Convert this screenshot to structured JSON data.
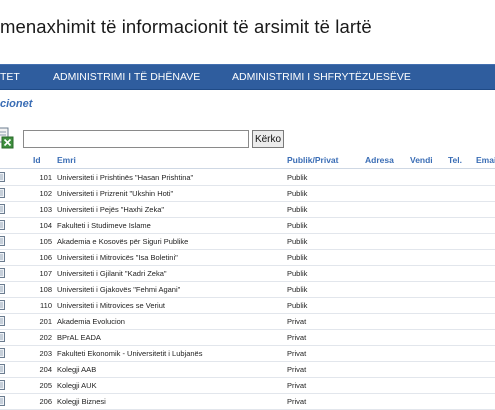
{
  "app": {
    "title": "menaxhimit të informacionit të arsimit të lartë"
  },
  "nav": {
    "items": [
      {
        "label": "TET"
      },
      {
        "label": "ADMINISTRIMI I TË DHËNAVE"
      },
      {
        "label": "ADMINISTRIMI I SHFRYTËZUESËVE"
      }
    ]
  },
  "section": {
    "title": "cionet"
  },
  "search": {
    "value": "",
    "placeholder": "",
    "button_label": "Kërko"
  },
  "table": {
    "columns": [
      "Id",
      "Emri",
      "Publik/Privat",
      "Adresa",
      "Vendi",
      "Tel.",
      "Emai"
    ],
    "rows": [
      {
        "id": "101",
        "name": "Universiteti i Prishtinës \"Hasan Prishtina\"",
        "type": "Publik"
      },
      {
        "id": "102",
        "name": "Universiteti i Prizrenit \"Ukshin Hoti\"",
        "type": "Publik"
      },
      {
        "id": "103",
        "name": "Universiteti i Pejës \"Haxhi Zeka\"",
        "type": "Publik"
      },
      {
        "id": "104",
        "name": "Fakulteti i Studimeve Islame",
        "type": "Publik"
      },
      {
        "id": "105",
        "name": "Akademia e Kosovës për Siguri Publike",
        "type": "Publik"
      },
      {
        "id": "106",
        "name": "Universiteti i Mitrovicës \"Isa Boletini\"",
        "type": "Publik"
      },
      {
        "id": "107",
        "name": "Universiteti i Gjilanit \"Kadri Zeka\"",
        "type": "Publik"
      },
      {
        "id": "108",
        "name": "Universiteti i Gjakovës \"Fehmi Agani\"",
        "type": "Publik"
      },
      {
        "id": "110",
        "name": "Universiteti i Mitrovices se Veriut",
        "type": "Publik"
      },
      {
        "id": "201",
        "name": "Akademia Evolucion",
        "type": "Privat"
      },
      {
        "id": "202",
        "name": "BPrAL EADA",
        "type": "Privat"
      },
      {
        "id": "203",
        "name": "Fakulteti Ekonomik - Universitetit i Lubjanës",
        "type": "Privat"
      },
      {
        "id": "204",
        "name": "Kolegji AAB",
        "type": "Privat"
      },
      {
        "id": "205",
        "name": "Kolegji AUK",
        "type": "Privat"
      },
      {
        "id": "206",
        "name": "Kolegji Biznesi",
        "type": "Privat"
      }
    ]
  }
}
